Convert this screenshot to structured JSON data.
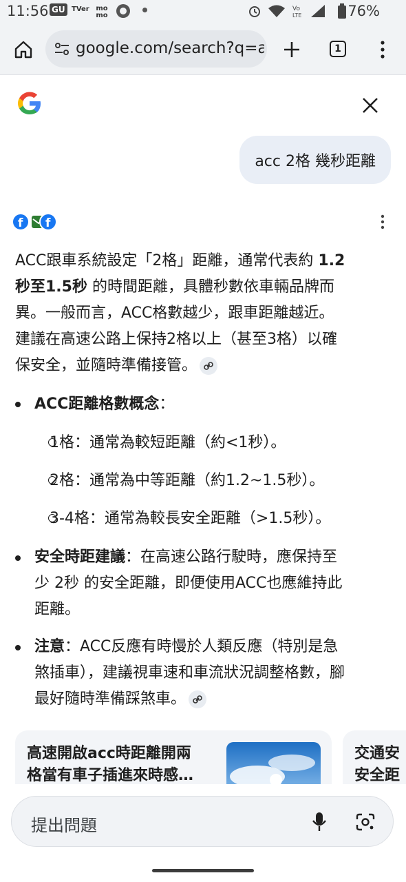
{
  "status_bar": {
    "time": "11:56",
    "apps": [
      "GU",
      "TVer",
      "mo mo"
    ],
    "battery": "76%"
  },
  "browser": {
    "url": "google.com/search?q=a",
    "tab_count": "1"
  },
  "query": "acc 2格 幾秒距離",
  "answer": {
    "line1_prefix": "ACC跟車系統設定「2格」距離，通常代表約 ",
    "line1_bold": "1.2",
    "line2_bold": "秒至1.5秒",
    "line2_rest": " 的時間距離，具體秒數依車輛品牌而",
    "line3": "異。一般而言，ACC格數越少，跟車距離越近。",
    "line4": "建議在高速公路上保持2格以上（甚至3格）以確",
    "line5": "保安全，並隨時準備接管。"
  },
  "bullets": {
    "b1_title": "ACC距離格數概念",
    "b1_colon": "：",
    "sub1": "1格：通常為較短距離（約<1秒）。",
    "sub2": "2格：通常為中等距離（約1.2~1.5秒）。",
    "sub3": "3-4格：通常為較長安全距離（>1.5秒）。",
    "b2_title": "安全時距建議",
    "b2_line1": "：在高速公路行駛時，應保持至",
    "b2_line2": "少 2秒 的安全距離，即便使用ACC也應維持此",
    "b2_line3": "距離。",
    "b3_title": "注意",
    "b3_line1": "：ACC反應有時慢於人類反應（特別是急",
    "b3_line2": "煞插車），建議視車速和車流狀況調整格數，腳",
    "b3_line3": "最好隨時準備踩煞車。"
  },
  "cards": [
    {
      "title_line1": "高速開啟acc時距離開兩",
      "title_line2": "格當有車子插進來時感…"
    },
    {
      "title_line1": "交通安",
      "title_line2": "安全距"
    }
  ],
  "ask_placeholder": "提出問題",
  "colors": {
    "accent_blue": "#1a73e8",
    "bubble": "#e9eef6",
    "chrome": "#f1f3f5"
  }
}
